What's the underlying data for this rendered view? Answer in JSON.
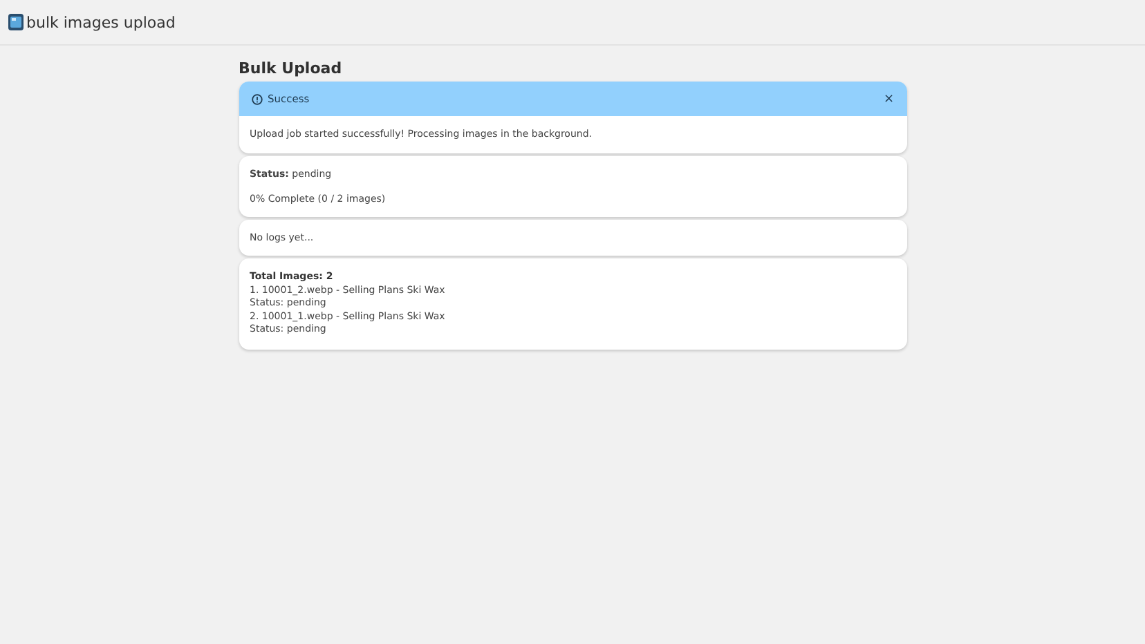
{
  "app_bar": {
    "title": "bulk images upload"
  },
  "page_title": "Bulk Upload",
  "alert": {
    "title": "Success",
    "close": "×",
    "message": "Upload job started successfully! Processing images in the background."
  },
  "status_card": {
    "status": "**Status:** pending",
    "progress": "0% Complete (0 / 2 images)"
  },
  "logs_card": {
    "text": "No logs yet..."
  },
  "images_card": {
    "total": "Total Images: 2",
    "lines": [
      "1. 10001_2.webp - Selling Plans Ski Wax",
      "Status: pending",
      "2. 10001_1.webp - Selling Plans Ski Wax",
      "Status: pending"
    ]
  }
}
